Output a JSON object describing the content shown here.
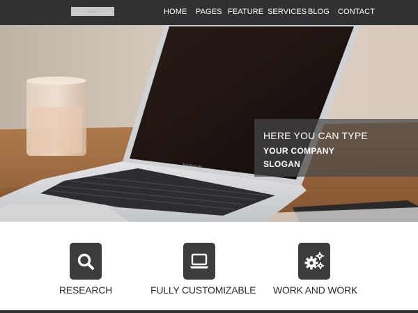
{
  "nav": {
    "logo_text": "LOGO",
    "items": [
      {
        "label": "HOME"
      },
      {
        "label": "PAGES"
      },
      {
        "label": "FEATURE"
      },
      {
        "label": "SERVICES"
      },
      {
        "label": "BLOG"
      },
      {
        "label": "CONTACT"
      }
    ]
  },
  "hero": {
    "slogan_line1": "HERE YOU CAN TYPE",
    "slogan_line2": "YOUR COMPANY",
    "slogan_line3": "SLOGAN",
    "laptop_brand": "MacBook Air"
  },
  "features": [
    {
      "label": "RESEARCH",
      "icon": "search-icon"
    },
    {
      "label": "FULLY CUSTOMIZABLE",
      "icon": "laptop-icon"
    },
    {
      "label": "WORK AND WORK",
      "icon": "gears-icon"
    }
  ],
  "colors": {
    "navbar": "#2f3133",
    "icon_tile": "#3c3d3f",
    "slogan_overlay": "rgba(70,70,70,0.72)"
  }
}
